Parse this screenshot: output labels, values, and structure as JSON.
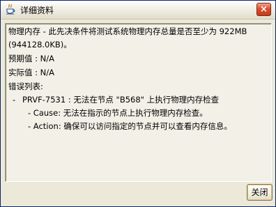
{
  "window": {
    "title": "详细资料",
    "close_glyph": "×"
  },
  "content": {
    "description_line1": "物理内存 - 此先决条件将测试系统物理内存总量是否至少为 922MB",
    "description_line2": "(944128.0KB)。",
    "expected_label": "预期值 : N/A",
    "actual_label": "实际值 : N/A",
    "error_list_label": "错误列表:",
    "errors": [
      {
        "dash": "-",
        "summary": "PRVF-7531 : 无法在节点 \"B568\" 上执行物理内存检查",
        "cause": "- Cause:  无法在指示的节点上执行物理内存检查。",
        "action": "- Action:  确保可以访问指定的节点并可以查看内存信息。"
      }
    ]
  },
  "footer": {
    "close_button_label": "关闭"
  },
  "colors": {
    "window_bg": "#ece9d8",
    "content_bg": "#f2f0e7",
    "title_close_red": "#d9502e"
  }
}
